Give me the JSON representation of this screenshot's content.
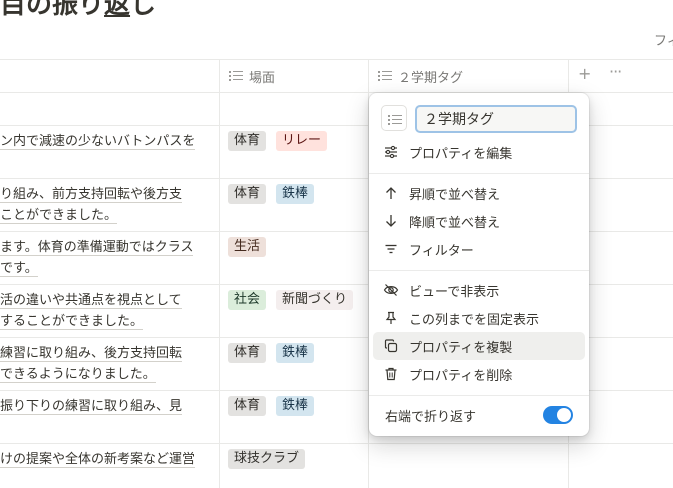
{
  "page": {
    "title_prefix": "目の振り",
    "title_underlined": "返",
    "title_suffix": "し",
    "filter_label": "フィ"
  },
  "table": {
    "columns": [
      {
        "label": "場面",
        "icon": "list-icon"
      },
      {
        "label": "２学期タグ",
        "icon": "list-icon"
      }
    ],
    "add_column": "+",
    "more_options": "···",
    "rows": [
      {
        "lines": [
          "ン内で減速の少ないバトンパスを"
        ],
        "tags": [
          {
            "label": "体育",
            "color": "gray"
          },
          {
            "label": "リレー",
            "color": "red"
          }
        ]
      },
      {
        "lines": [
          "り組み、前方支持回転や後方支",
          "ことができました。"
        ],
        "tags": [
          {
            "label": "体育",
            "color": "gray"
          },
          {
            "label": "鉄棒",
            "color": "blue"
          }
        ]
      },
      {
        "lines": [
          "ます。体育の準備運動ではクラス",
          "です。"
        ],
        "tags": [
          {
            "label": "生活",
            "color": "brown"
          }
        ]
      },
      {
        "lines": [
          "活の違いや共通点を視点として",
          "することができました。"
        ],
        "tags": [
          {
            "label": "社会",
            "color": "green"
          },
          {
            "label": "新聞づくり",
            "color": "beige"
          }
        ]
      },
      {
        "lines": [
          "練習に取り組み、後方支持回転",
          "できるようになりました。"
        ],
        "tags": [
          {
            "label": "体育",
            "color": "gray"
          },
          {
            "label": "鉄棒",
            "color": "blue"
          }
        ]
      },
      {
        "lines": [
          "振り下りの練習に取り組み、見"
        ],
        "tags": [
          {
            "label": "体育",
            "color": "gray"
          },
          {
            "label": "鉄棒",
            "color": "blue"
          }
        ]
      },
      {
        "lines": [
          "けの提案や全体の新考案など運営"
        ],
        "tags": [
          {
            "label": "球技クラブ",
            "color": "gray"
          }
        ]
      }
    ]
  },
  "property_menu": {
    "name_value": "２学期タグ",
    "edit_property": "プロパティを編集",
    "sort_ascending": "昇順で並べ替え",
    "sort_descending": "降順で並べ替え",
    "filter": "フィルター",
    "hide_in_view": "ビューで非表示",
    "freeze_up_to_column": "この列までを固定表示",
    "duplicate_property": "プロパティを複製",
    "delete_property": "プロパティを削除",
    "wrap_column": "右端で折り返す",
    "wrap_enabled": true,
    "accent_color": "#2383e2"
  }
}
